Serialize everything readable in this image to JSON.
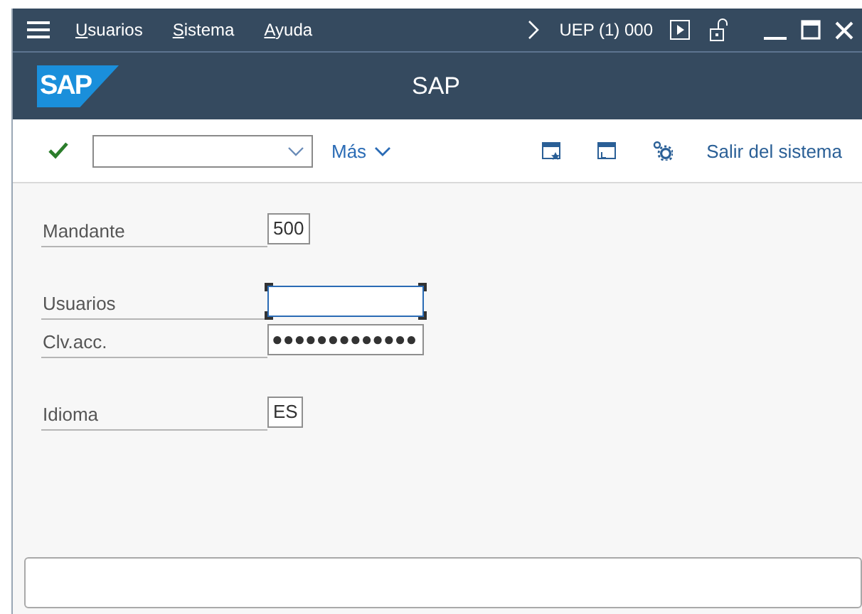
{
  "menu_bar": {
    "items": [
      {
        "label": "Usuarios",
        "underline_first": true
      },
      {
        "label": "Sistema",
        "underline_first": true
      },
      {
        "label": "Ayuda",
        "underline_first": true
      }
    ],
    "system": "UEP (1) 000"
  },
  "header": {
    "logo": "SAP",
    "title": "SAP"
  },
  "toolbar": {
    "more": "Más",
    "exit": "Salir del sistema"
  },
  "field_groups": [
    [
      {
        "label": "Mandante",
        "value": "500",
        "kind": "short",
        "focused": false
      }
    ],
    [
      {
        "label": "Usuarios",
        "kind": "long",
        "focused": true
      },
      {
        "label": "Clv.acc.",
        "value": "●●●●●●●●●●●●●",
        "kind": "long",
        "focused": false
      }
    ],
    [
      {
        "label": "Idioma",
        "value": "ES",
        "kind": "short",
        "focused": false
      }
    ]
  ],
  "status_bar": {
    "kind": "empty"
  }
}
